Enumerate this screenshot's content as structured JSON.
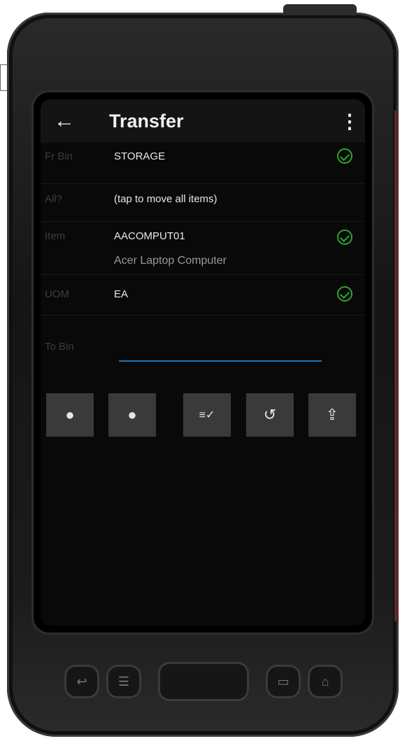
{
  "app": {
    "title": "Transfer",
    "back_icon": "←",
    "menu_icon": "⋮"
  },
  "form": {
    "fr_bin": {
      "label": "Fr Bin",
      "value": "STORAGE"
    },
    "all": {
      "label": "All?",
      "value": "(tap to move all items)"
    },
    "item": {
      "label": "Item",
      "value": "AACOMPUT01",
      "description": "Acer Laptop Computer"
    },
    "uom": {
      "label": "UOM",
      "value": "EA"
    },
    "to_bin": {
      "label": "To Bin",
      "value": ""
    }
  },
  "toolbar": {
    "buttons": [
      {
        "icon": "scan-icon",
        "glyph": "●"
      },
      {
        "icon": "camera-icon",
        "glyph": "●"
      },
      {
        "icon": "checklist-icon",
        "glyph": "≡✓"
      },
      {
        "icon": "undo-icon",
        "glyph": "↺"
      },
      {
        "icon": "upload-icon",
        "glyph": "⇪"
      }
    ]
  },
  "colors": {
    "check": "#2ea52a",
    "underline": "#1a7bb5",
    "button_bg": "#3a3a3a"
  }
}
